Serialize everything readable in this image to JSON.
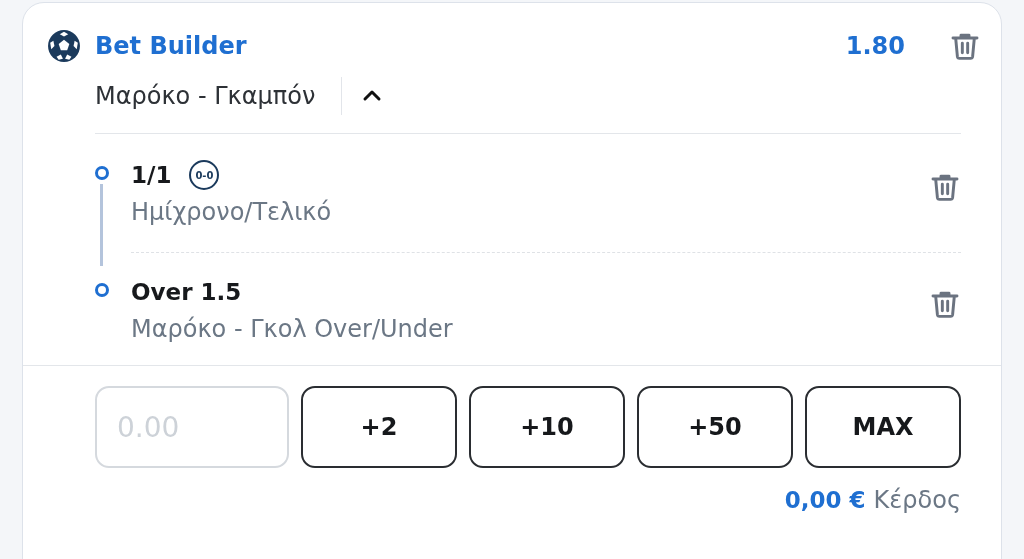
{
  "header": {
    "title": "Bet Builder",
    "odds": "1.80",
    "match": "Μαρόκο - Γκαμπόν",
    "expanded": true
  },
  "legs": [
    {
      "selection": "1/1",
      "badge": "0-0",
      "market": "Ημίχρονο/Τελικό"
    },
    {
      "selection": "Over 1.5",
      "market": "Μαρόκο - Γκολ Over/Under"
    }
  ],
  "stake": {
    "placeholder": "0.00",
    "quick_buttons": [
      "+2",
      "+10",
      "+50",
      "MAX"
    ]
  },
  "footer": {
    "amount": "0,00 €",
    "label": "Κέρδος"
  }
}
